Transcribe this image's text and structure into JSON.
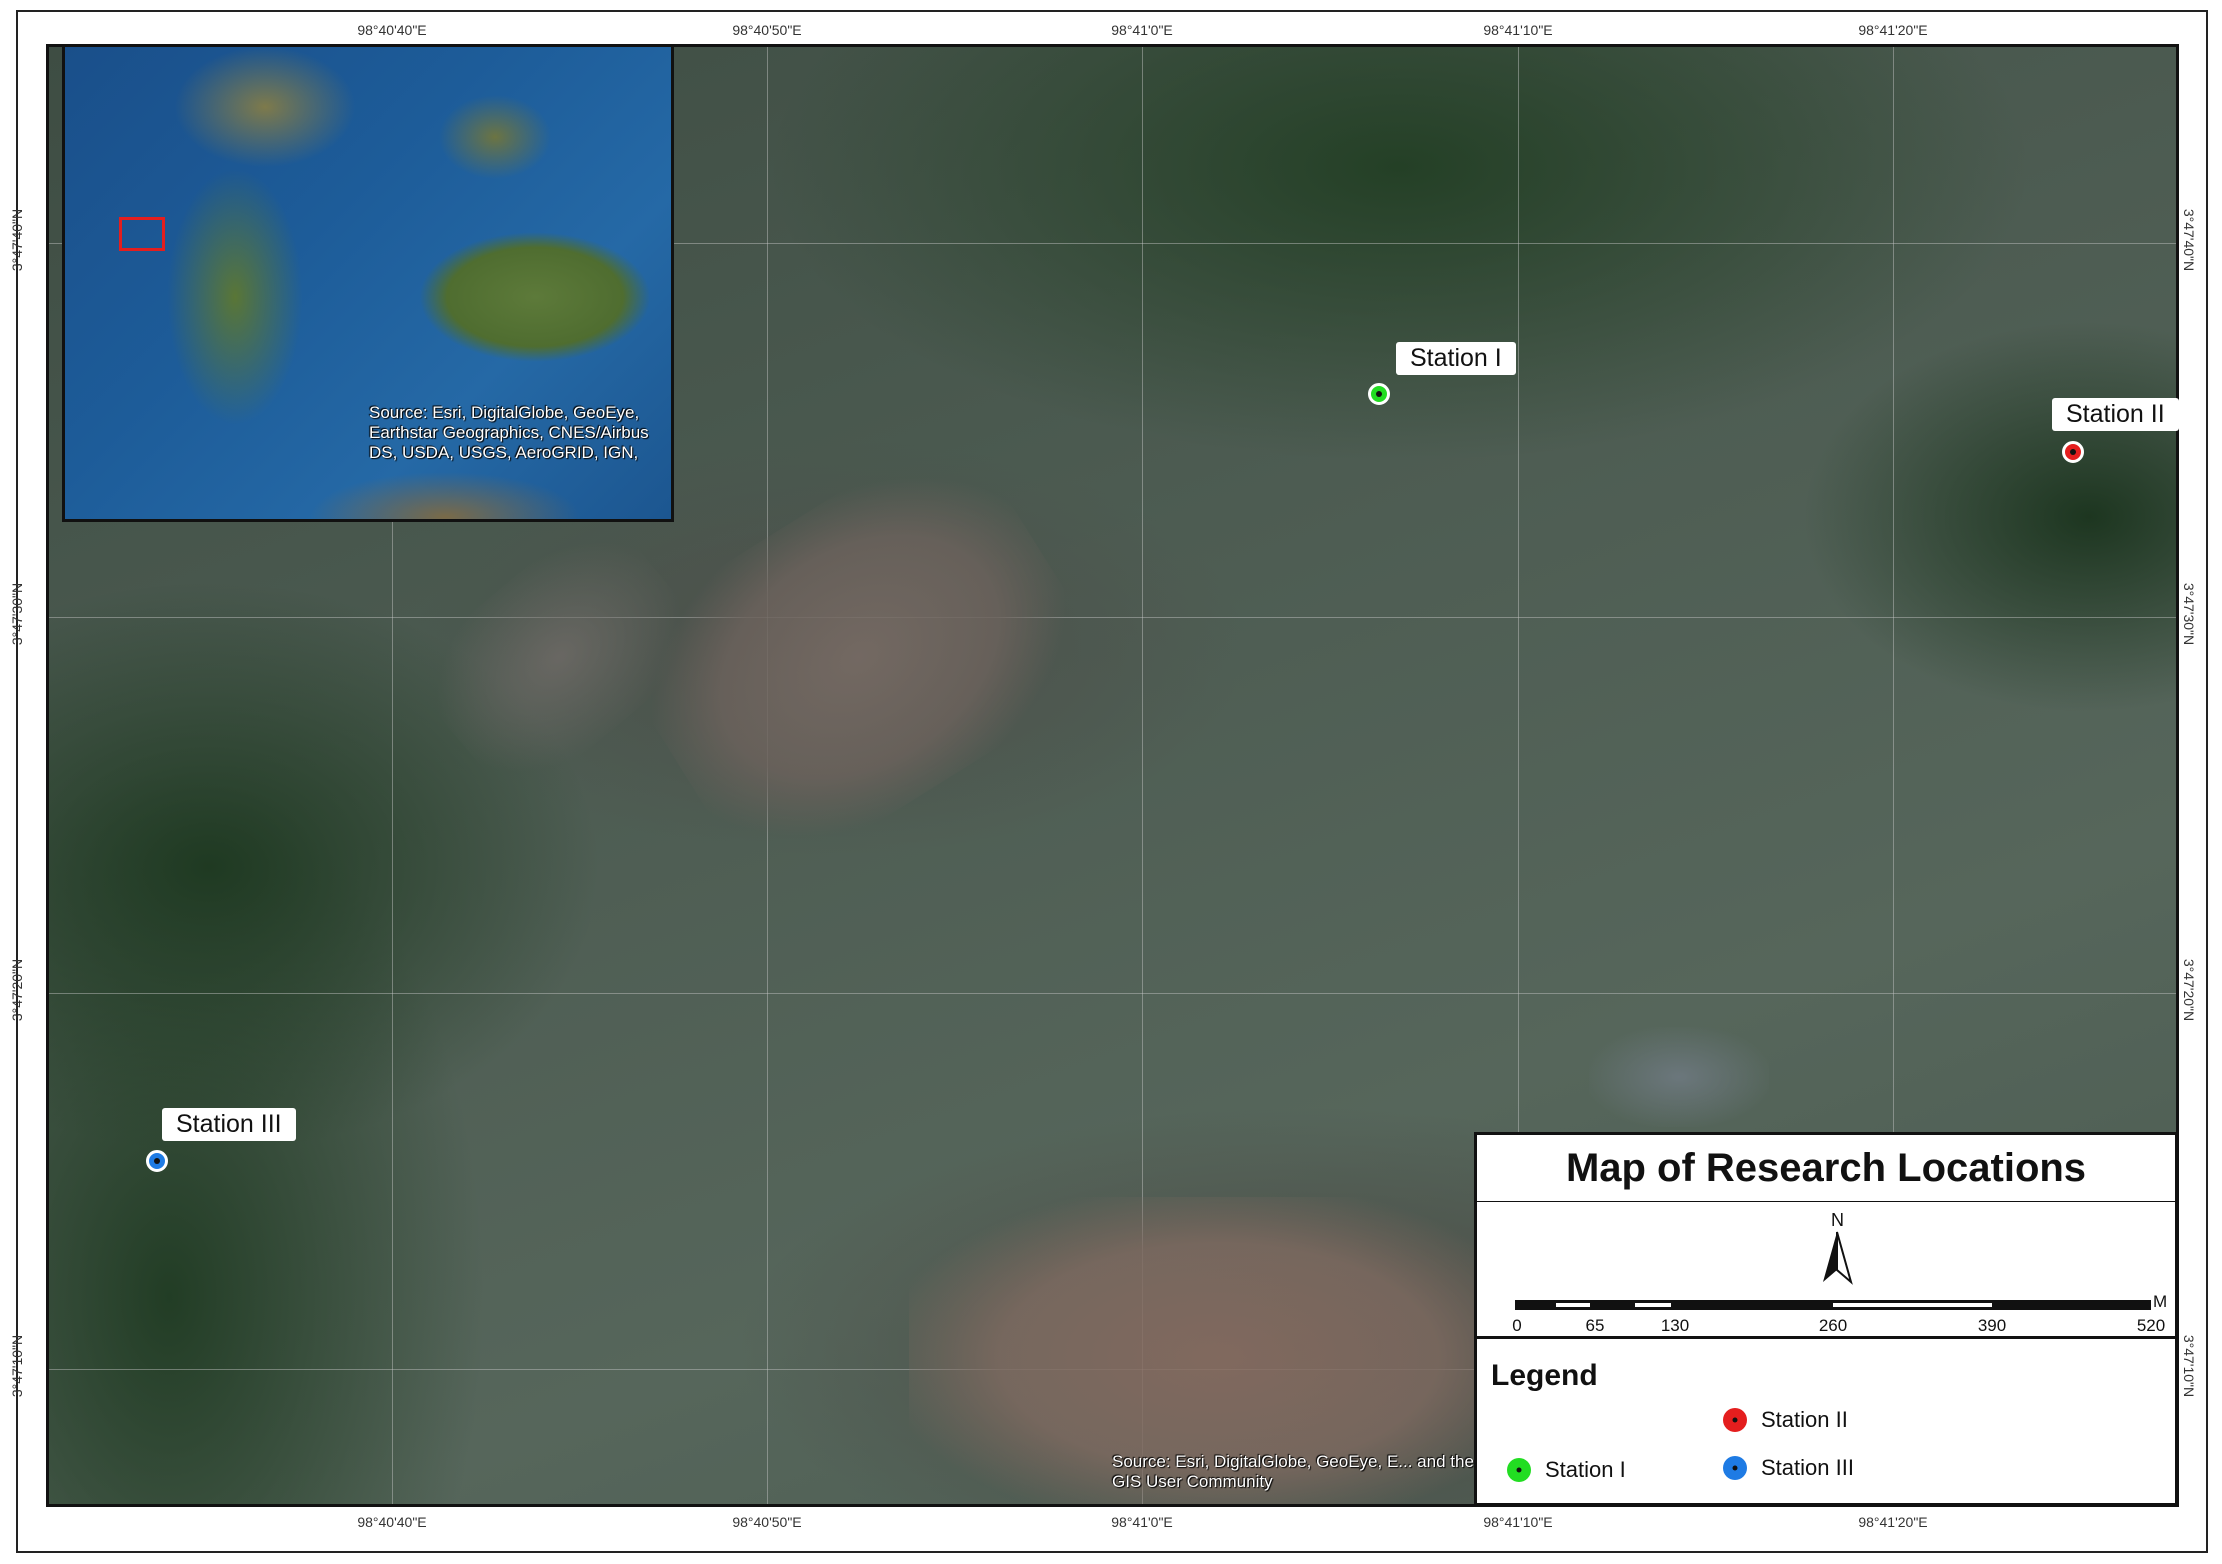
{
  "map": {
    "title": "Map of Research Locations",
    "coordinates": {
      "top": [
        "98°40'40\"E",
        "98°40'50\"E",
        "98°41'0\"E",
        "98°41'10\"E",
        "98°41'20\"E"
      ],
      "bottom": [
        "98°40'40\"E",
        "98°40'50\"E",
        "98°41'0\"E",
        "98°41'10\"E",
        "98°41'20\"E"
      ],
      "left": [
        "3°47'40\"N",
        "3°47'30\"N",
        "3°47'20\"N",
        "3°47'10\"N"
      ],
      "right": [
        "3°47'40\"N",
        "3°47'30\"N",
        "3°47'20\"N",
        "3°47'10\"N"
      ]
    },
    "stations": [
      {
        "label": "Station I",
        "color": "#22dd22"
      },
      {
        "label": "Station II",
        "color": "#e41e1e"
      },
      {
        "label": "Station III",
        "color": "#1e7be4"
      }
    ],
    "inset_source": "Source: Esri, DigitalGlobe, GeoEye, Earthstar Geographics, CNES/Airbus DS, USDA, USGS, AeroGRID, IGN,",
    "map_source": "Source: Esri, DigitalGlobe, GeoEye, E... and the GIS User Community",
    "north": "N",
    "scale": {
      "unit": "M",
      "ticks": [
        "0",
        "65",
        "130",
        "260",
        "390",
        "520"
      ]
    },
    "legend": {
      "title": "Legend",
      "items": [
        {
          "label": "Station II",
          "color": "#e41e1e"
        },
        {
          "label": "Station I",
          "color": "#22dd22"
        },
        {
          "label": "Station III",
          "color": "#1e7be4"
        }
      ]
    }
  }
}
